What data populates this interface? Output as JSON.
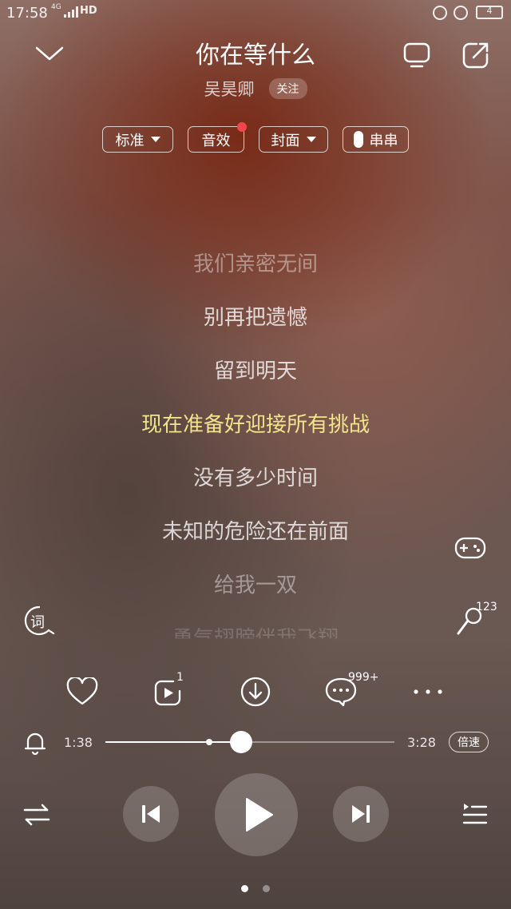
{
  "status_bar": {
    "time": "17:58",
    "network": "4G",
    "hd": "HD",
    "battery": "4"
  },
  "header": {
    "title": "你在等什么",
    "artist": "吴昊卿",
    "follow_label": "关注"
  },
  "options": {
    "quality": "标准",
    "effects": "音效",
    "cover": "封面",
    "chuanchuan": "串串"
  },
  "lyrics": [
    "我们亲密无间",
    "别再把遗憾",
    "留到明天",
    "现在准备好迎接所有挑战",
    "没有多少时间",
    "未知的危险还在前面",
    "给我一双",
    "勇气翅膀伴我飞翔"
  ],
  "lyrics_active_index": 3,
  "side": {
    "lyric_icon_label": "词",
    "mic_count": "123"
  },
  "actions": {
    "mv_count": "1",
    "comment_count": "999+"
  },
  "progress": {
    "current": "1:38",
    "total": "3:28",
    "played_fraction": 0.47,
    "buffered_fraction": 0.36,
    "speed_label": "倍速"
  },
  "icons": {
    "collapse": "chevron-down-icon",
    "screen": "screen-icon",
    "share": "share-icon",
    "game": "gamepad-icon",
    "mic": "microphone-icon",
    "like": "heart-icon",
    "mv": "video-icon",
    "download": "download-icon",
    "comment": "comment-icon",
    "more": "more-icon",
    "alarm": "bell-icon",
    "shuffle": "shuffle-icon",
    "prev": "previous-icon",
    "play": "play-icon",
    "next": "next-icon",
    "playlist": "playlist-icon"
  },
  "pager": {
    "pages": 2,
    "current": 0
  }
}
